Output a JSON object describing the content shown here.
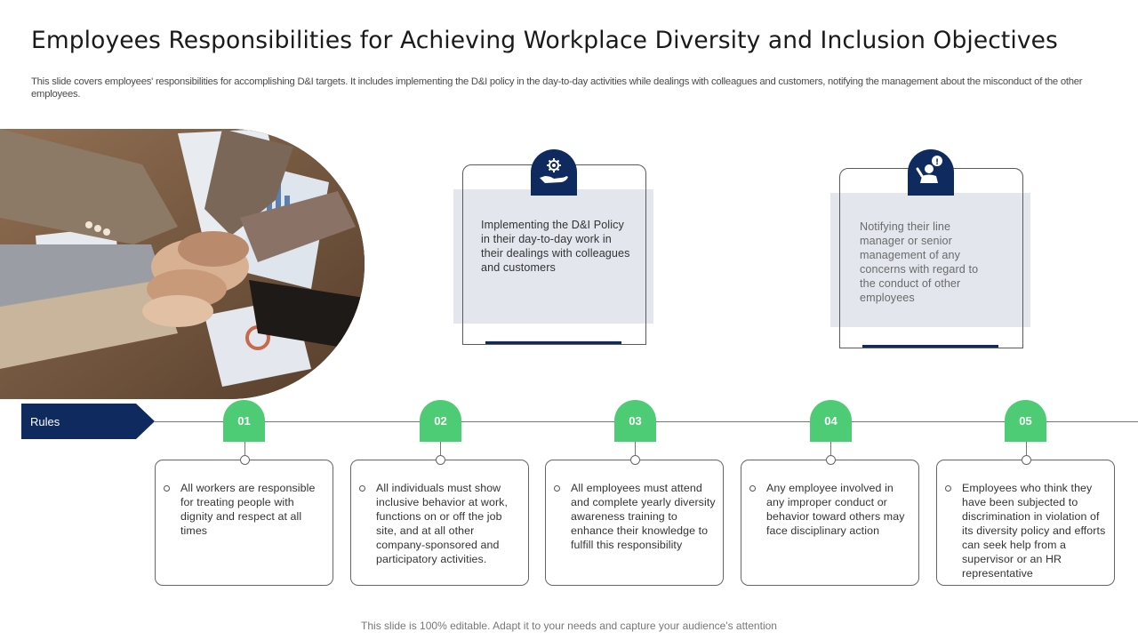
{
  "header": {
    "title": "Employees Responsibilities for Achieving Workplace Diversity and Inclusion Objectives",
    "subtitle": "This slide covers employees' responsibilities for accomplishing D&I targets. It includes implementing the D&I policy in the day-to-day activities while dealings with colleagues and customers, notifying the management about the misconduct of the other employees."
  },
  "top_cards": [
    {
      "text": "Implementing the D&I Policy in their day-to-day work in their dealings with colleagues and customers",
      "icon": "hand-gear-icon"
    },
    {
      "text": "Notifying their line manager or senior management of any concerns with regard to the conduct of other employees",
      "icon": "person-alert-icon"
    }
  ],
  "timeline": {
    "label": "Rules",
    "steps": [
      {
        "number": "01",
        "text": "All workers are responsible for treating people with dignity and respect at all times"
      },
      {
        "number": "02",
        "text": "All individuals must show inclusive behavior at work, functions on or off the job site, and at all other company-sponsored and participatory activities."
      },
      {
        "number": "03",
        "text": "All employees must attend and complete yearly diversity awareness training to enhance their knowledge to fulfill this responsibility"
      },
      {
        "number": "04",
        "text": "Any employee involved in any improper conduct or behavior toward others may face disciplinary action"
      },
      {
        "number": "05",
        "text": "Employees who think they have been subjected to discrimination in violation of its diversity policy and efforts can seek help from a supervisor or an HR representative"
      }
    ]
  },
  "footer": "This slide is 100% editable. Adapt it to your needs and capture your audience's attention",
  "colors": {
    "navy": "#0f2a5e",
    "green": "#4ecc75",
    "card_fill": "#e3e6ec"
  }
}
